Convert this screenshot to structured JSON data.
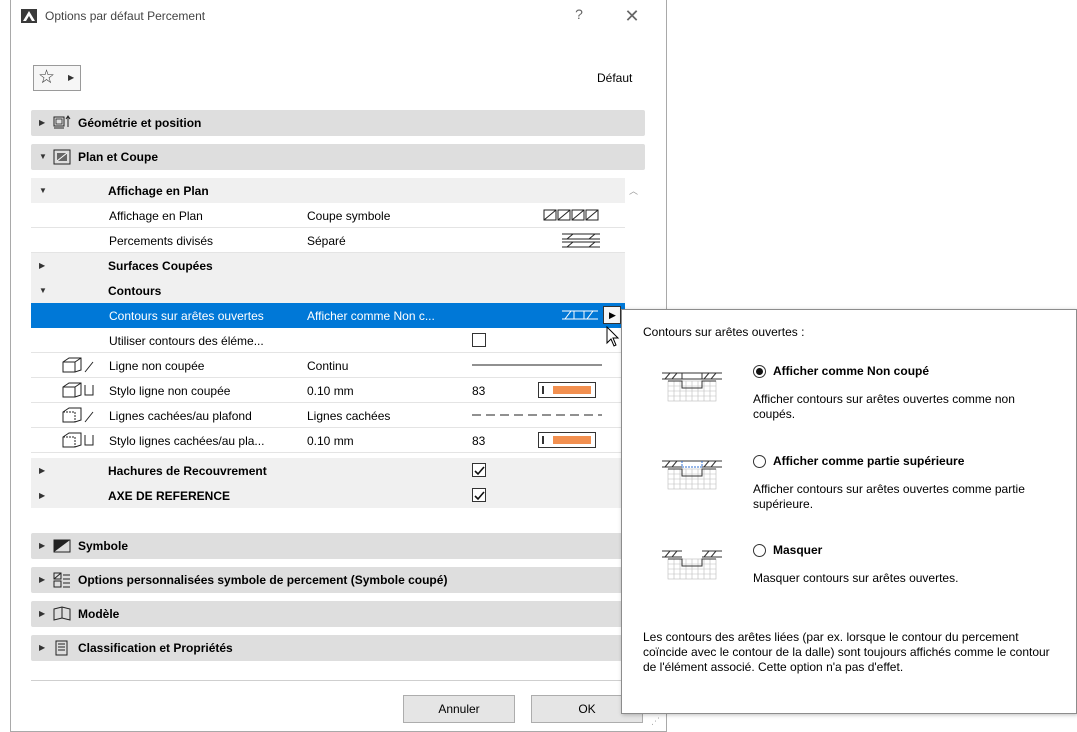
{
  "window": {
    "title": "Options par défaut Percement",
    "help_label": "?",
    "close_label": "✕"
  },
  "toolbar": {
    "favorites_icon": "star-icon",
    "default_label": "Défaut"
  },
  "sections": {
    "geometry": "Géométrie et position",
    "plan": "Plan et Coupe",
    "symbol": "Symbole",
    "custom_options": "Options personnalisées symbole de percement (Symbole coupé)",
    "model": "Modèle",
    "classification": "Classification et Propriétés"
  },
  "tree": {
    "affichage_group": "Affichage en Plan",
    "affichage_row": {
      "name": "Affichage en Plan",
      "value": "Coupe symbole"
    },
    "divises_row": {
      "name": "Percements divisés",
      "value": "Séparé"
    },
    "surfaces_group": "Surfaces Coupées",
    "contours_group": "Contours",
    "contours_row": {
      "name": "Contours sur arêtes ouvertes",
      "value": "Afficher comme Non c..."
    },
    "utiliser_row": {
      "name": "Utiliser contours des éléme..."
    },
    "ligne_row": {
      "name": "Ligne non coupée",
      "value": "Continu"
    },
    "stylo_row": {
      "name": "Stylo ligne non coupée",
      "value": "0.10 mm",
      "pen": "83"
    },
    "cachees_row": {
      "name": "Lignes cachées/au plafond",
      "value": "Lignes cachées"
    },
    "stylo_cachees_row": {
      "name": "Stylo lignes cachées/au pla...",
      "value": "0.10 mm",
      "pen": "83"
    },
    "hachures_group": "Hachures de Recouvrement",
    "axe_group": "AXE DE REFERENCE"
  },
  "buttons": {
    "cancel": "Annuler",
    "ok": "OK"
  },
  "tooltip": {
    "title": "Contours sur arêtes ouvertes :",
    "options": [
      {
        "label": "Afficher comme Non coupé",
        "desc": "Afficher contours sur arêtes ouvertes comme non coupés.",
        "selected": true
      },
      {
        "label": "Afficher comme partie supérieure",
        "desc": "Afficher contours sur arêtes ouvertes comme partie supérieure.",
        "selected": false
      },
      {
        "label": "Masquer",
        "desc": "Masquer contours sur arêtes ouvertes.",
        "selected": false
      }
    ],
    "note": "Les contours des arêtes liées (par ex. lorsque le contour du percement coïncide avec le contour de la dalle) sont toujours affichés comme le contour de l'élément associé. Cette option n'a pas d'effet."
  },
  "colors": {
    "selection": "#0078d7",
    "section_header": "#dedede",
    "pen_color": "#f29050"
  }
}
